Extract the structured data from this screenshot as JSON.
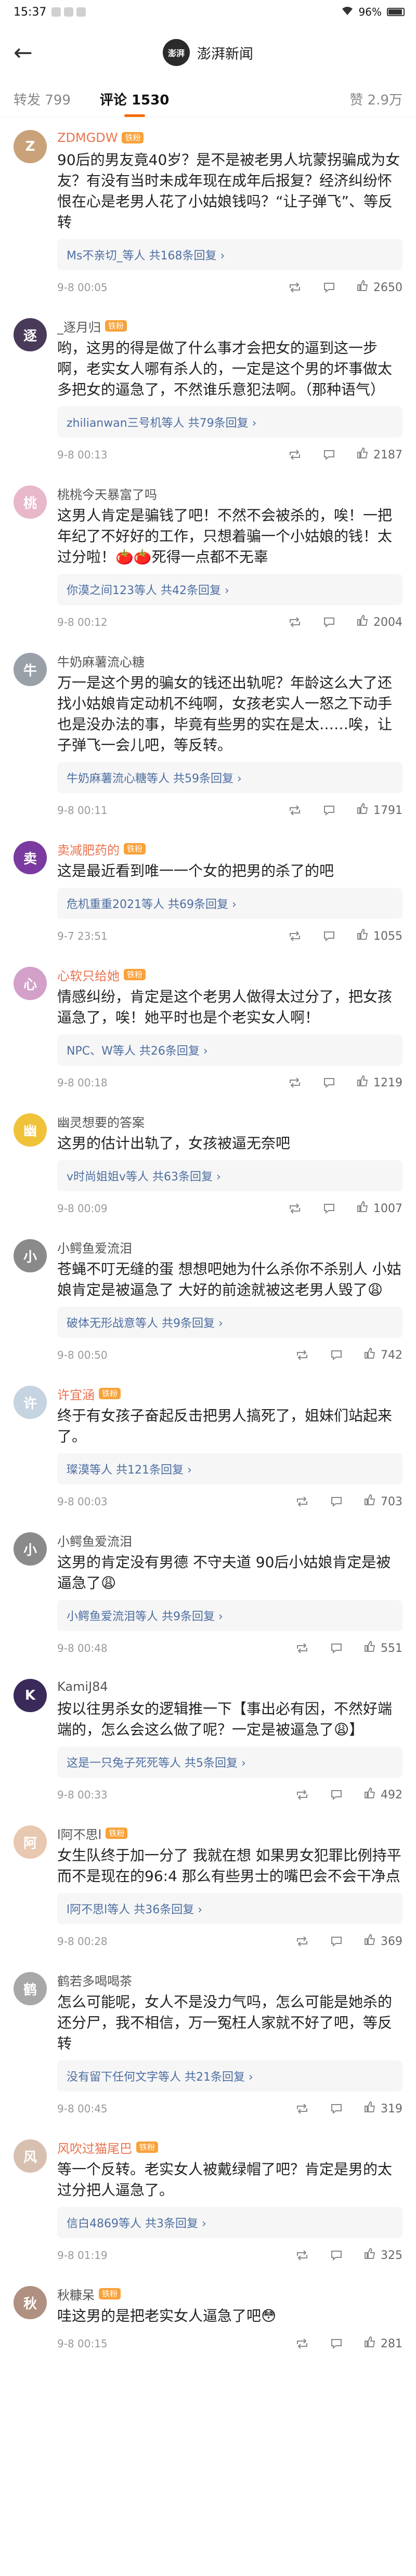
{
  "status": {
    "time": "15:37",
    "battery": "96%"
  },
  "nav": {
    "back": "←",
    "brand_logo": "澎湃",
    "brand_name": "澎湃新闻"
  },
  "tabs": {
    "repost": "转发 799",
    "comments": "评论 1530",
    "likes": "赞 2.9万"
  },
  "comments": [
    {
      "user": "ZDMGDW",
      "badge": "铁粉",
      "avatar_color": "#c9a27a",
      "avatar_char": "Z",
      "orange": true,
      "text": "90后的男友竟40岁？是不是被老男人坑蒙拐骗成为女友？有没有当时未成年现在成年后报复？经济纠纷怀恨在心是老男人花了小姑娘钱吗？“让子弹飞”、等反转",
      "reply": "Ms不亲切_等人",
      "reply_count": "共168条回复",
      "time": "9-8 00:05",
      "likes": "2650"
    },
    {
      "user": "_逐月归",
      "badge": "铁粉",
      "avatar_color": "#4a3a5a",
      "avatar_char": "逐",
      "orange": false,
      "text": "哟，这男的得是做了什么事才会把女的逼到这一步啊，老实女人哪有杀人的，一定是这个男的坏事做太多把女的逼急了，不然谁乐意犯法啊。（那种语气）",
      "reply": "zhilianwan三号机等人",
      "reply_count": "共79条回复",
      "time": "9-8 00:13",
      "likes": "2187"
    },
    {
      "user": "桃桃今天暴富了吗",
      "badge": "",
      "avatar_color": "#e8b7c9",
      "avatar_char": "桃",
      "orange": false,
      "text": "这男人肯定是骗钱了吧！不然不会被杀的，唉！一把年纪了不好好的工作，只想着骗一个小姑娘的钱！太过分啦！🍅🍅死得一点都不无辜",
      "reply": "你漠之间123等人",
      "reply_count": "共42条回复",
      "time": "9-8 00:12",
      "likes": "2004"
    },
    {
      "user": "牛奶麻薯流心糖",
      "badge": "",
      "avatar_color": "#9aa0a8",
      "avatar_char": "牛",
      "orange": false,
      "text": "万一是这个男的骗女的钱还出轨呢？年龄这么大了还找小姑娘肯定动机不纯啊，女孩老实人一怒之下动手也是没办法的事，毕竟有些男的实在是太……唉，让子弹飞一会儿吧，等反转。",
      "reply": "牛奶麻薯流心糖等人",
      "reply_count": "共59条回复",
      "time": "9-8 00:11",
      "likes": "1791"
    },
    {
      "user": "卖减肥药的",
      "badge": "铁粉",
      "avatar_color": "#7a3aa0",
      "avatar_char": "卖",
      "orange": true,
      "text": "这是最近看到唯一一个女的把男的杀了的吧",
      "reply": "危机重重2021等人",
      "reply_count": "共69条回复",
      "time": "9-7 23:51",
      "likes": "1055"
    },
    {
      "user": "心软只给她",
      "badge": "铁粉",
      "avatar_color": "#d2a0c8",
      "avatar_char": "心",
      "orange": true,
      "text": "情感纠纷，肯定是这个老男人做得太过分了，把女孩逼急了，唉！她平时也是个老实女人啊！",
      "reply": "NPC、W等人",
      "reply_count": "共26条回复",
      "time": "9-8 00:18",
      "likes": "1219"
    },
    {
      "user": "幽灵想要的答案",
      "badge": "",
      "avatar_color": "#f0c23a",
      "avatar_char": "幽",
      "orange": false,
      "text": "这男的估计出轨了，女孩被逼无奈吧",
      "reply": "v时尚姐姐v等人",
      "reply_count": "共63条回复",
      "time": "9-8 00:09",
      "likes": "1007"
    },
    {
      "user": "小鳄鱼爱流泪",
      "badge": "",
      "avatar_color": "#8a8a8a",
      "avatar_char": "小",
      "orange": false,
      "text": "苍蝇不叮无缝的蛋 想想吧她为什么杀你不杀别人 小姑娘肯定是被逼急了 大好的前途就被这老男人毁了😩",
      "reply": "破体无形战意等人",
      "reply_count": "共9条回复",
      "time": "9-8 00:50",
      "likes": "742"
    },
    {
      "user": "许宜涵",
      "badge": "铁粉",
      "avatar_color": "#c6d3e0",
      "avatar_char": "许",
      "orange": true,
      "text": "终于有女孩子奋起反击把男人搞死了，姐妹们站起来了。",
      "reply": "璨漠等人",
      "reply_count": "共121条回复",
      "time": "9-8 00:03",
      "likes": "703"
    },
    {
      "user": "小鳄鱼爱流泪",
      "badge": "",
      "avatar_color": "#8a8a8a",
      "avatar_char": "小",
      "orange": false,
      "text": "这男的肯定没有男德 不守夫道 90后小姑娘肯定是被逼急了😩",
      "reply": "小鳄鱼爱流泪等人",
      "reply_count": "共9条回复",
      "time": "9-8 00:48",
      "likes": "551"
    },
    {
      "user": "KamiJ84",
      "badge": "",
      "avatar_color": "#3a2a5a",
      "avatar_char": "K",
      "orange": false,
      "text": "按以往男杀女的逻辑推一下【事出必有因，不然好端端的，怎么会这么做了呢？一定是被逼急了😩】",
      "reply": "这是一只兔子死死等人",
      "reply_count": "共5条回复",
      "time": "9-8 00:33",
      "likes": "492"
    },
    {
      "user": "l阿不思l",
      "badge": "铁粉",
      "avatar_color": "#e8c8b0",
      "avatar_char": "阿",
      "orange": false,
      "text": "女生队终于加一分了 我就在想 如果男女犯罪比例持平而不是现在的96:4 那么有些男士的嘴巴会不会干净点",
      "reply": "l阿不思l等人",
      "reply_count": "共36条回复",
      "time": "9-8 00:28",
      "likes": "369"
    },
    {
      "user": "鹤若多喝喝茶",
      "badge": "",
      "avatar_color": "#a8a8a8",
      "avatar_char": "鹤",
      "orange": false,
      "text": "怎么可能呢，女人不是没力气吗，怎么可能是她杀的还分尸，我不相信，万一冤枉人家就不好了吧，等反转",
      "reply": "没有留下任何文字等人",
      "reply_count": "共21条回复",
      "time": "9-8 00:45",
      "likes": "319"
    },
    {
      "user": "风吹过猫尾巴",
      "badge": "铁粉",
      "avatar_color": "#d8c0b0",
      "avatar_char": "风",
      "orange": true,
      "text": "等一个反转。老实女人被戴绿帽了吧？肯定是男的太过分把人逼急了。",
      "reply": "信白4869等人",
      "reply_count": "共3条回复",
      "time": "9-8 01:19",
      "likes": "325"
    },
    {
      "user": "秋糠呆",
      "badge": "铁粉",
      "avatar_color": "#b09080",
      "avatar_char": "秋",
      "orange": false,
      "text": "哇这男的是把老实女人逼急了吧😳",
      "reply": "",
      "reply_count": "",
      "time": "9-8 00:15",
      "likes": "281"
    }
  ],
  "icons": {
    "repost": "repost-icon",
    "comment": "comment-icon",
    "like": "thumb-up-icon"
  }
}
